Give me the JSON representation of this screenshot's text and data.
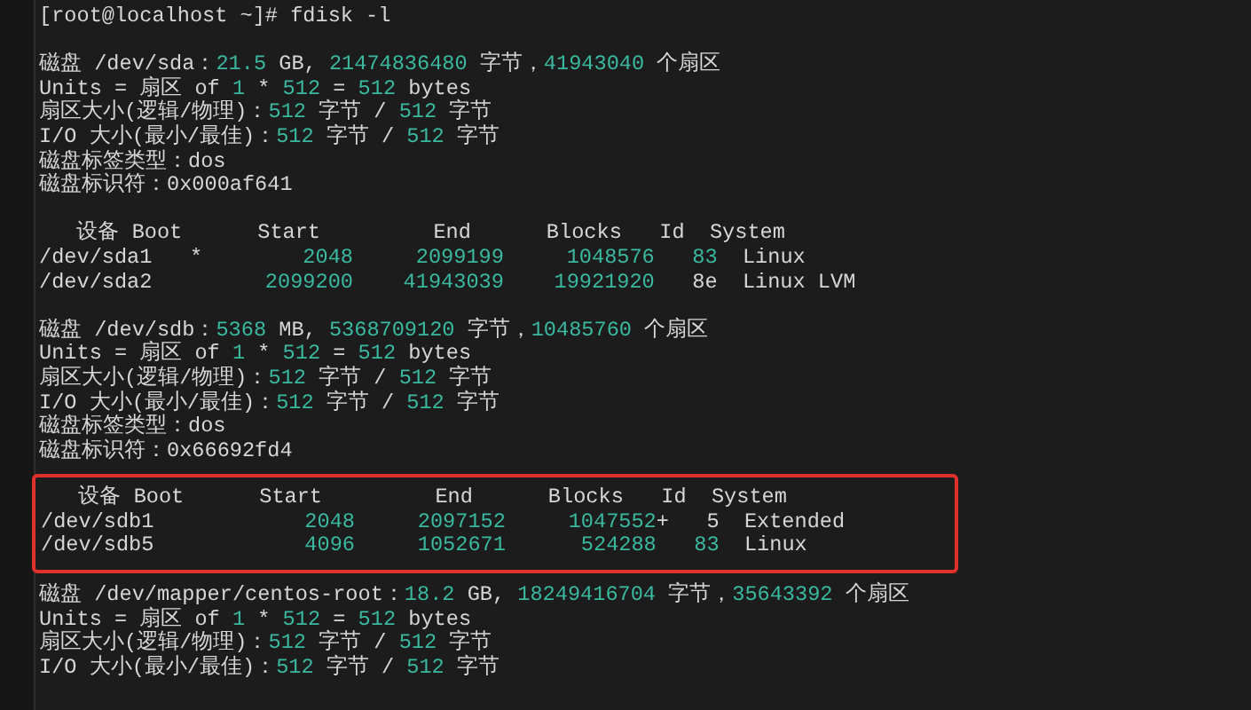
{
  "terminal": {
    "blocks": [
      {
        "highlighted": false,
        "lines": [
          {
            "kind": "text",
            "segments": [
              {
                "text": "[root@localhost ~]# fdisk -l",
                "kind": "plain"
              }
            ]
          },
          {
            "kind": "blank"
          },
          {
            "kind": "text",
            "segments": [
              {
                "text": "磁盘 /dev/sda：",
                "kind": "plain"
              },
              {
                "text": "21.5",
                "kind": "number"
              },
              {
                "text": " GB, ",
                "kind": "plain"
              },
              {
                "text": "21474836480",
                "kind": "number"
              },
              {
                "text": " 字节，",
                "kind": "plain"
              },
              {
                "text": "41943040",
                "kind": "number"
              },
              {
                "text": " 个扇区",
                "kind": "plain"
              }
            ]
          },
          {
            "kind": "text",
            "segments": [
              {
                "text": "Units = 扇区 of ",
                "kind": "plain"
              },
              {
                "text": "1",
                "kind": "number"
              },
              {
                "text": " * ",
                "kind": "plain"
              },
              {
                "text": "512",
                "kind": "number"
              },
              {
                "text": " = ",
                "kind": "plain"
              },
              {
                "text": "512",
                "kind": "number"
              },
              {
                "text": " bytes",
                "kind": "plain"
              }
            ]
          },
          {
            "kind": "text",
            "segments": [
              {
                "text": "扇区大小(逻辑/物理)：",
                "kind": "plain"
              },
              {
                "text": "512",
                "kind": "number"
              },
              {
                "text": " 字节 / ",
                "kind": "plain"
              },
              {
                "text": "512",
                "kind": "number"
              },
              {
                "text": " 字节",
                "kind": "plain"
              }
            ]
          },
          {
            "kind": "text",
            "segments": [
              {
                "text": "I/O 大小(最小/最佳)：",
                "kind": "plain"
              },
              {
                "text": "512",
                "kind": "number"
              },
              {
                "text": " 字节 / ",
                "kind": "plain"
              },
              {
                "text": "512",
                "kind": "number"
              },
              {
                "text": " 字节",
                "kind": "plain"
              }
            ]
          },
          {
            "kind": "text",
            "segments": [
              {
                "text": "磁盘标签类型：dos",
                "kind": "plain"
              }
            ]
          },
          {
            "kind": "text",
            "segments": [
              {
                "text": "磁盘标识符：0x000af641",
                "kind": "plain"
              }
            ]
          },
          {
            "kind": "blank"
          },
          {
            "kind": "text",
            "segments": [
              {
                "text": "   设备 Boot      Start         End      Blocks   Id  System",
                "kind": "plain"
              }
            ]
          },
          {
            "kind": "text",
            "segments": [
              {
                "text": "/dev/sda1   *",
                "kind": "plain"
              },
              {
                "text": "        2048     2099199     1048576   83",
                "kind": "number"
              },
              {
                "text": "  Linux",
                "kind": "plain"
              }
            ]
          },
          {
            "kind": "text",
            "segments": [
              {
                "text": "/dev/sda2",
                "kind": "plain"
              },
              {
                "text": "         2099200    41943039    19921920",
                "kind": "number"
              },
              {
                "text": "   8e  Linux LVM",
                "kind": "plain"
              }
            ]
          },
          {
            "kind": "blank"
          },
          {
            "kind": "text",
            "segments": [
              {
                "text": "磁盘 /dev/sdb：",
                "kind": "plain"
              },
              {
                "text": "5368",
                "kind": "number"
              },
              {
                "text": " MB, ",
                "kind": "plain"
              },
              {
                "text": "5368709120",
                "kind": "number"
              },
              {
                "text": " 字节，",
                "kind": "plain"
              },
              {
                "text": "10485760",
                "kind": "number"
              },
              {
                "text": " 个扇区",
                "kind": "plain"
              }
            ]
          },
          {
            "kind": "text",
            "segments": [
              {
                "text": "Units = 扇区 of ",
                "kind": "plain"
              },
              {
                "text": "1",
                "kind": "number"
              },
              {
                "text": " * ",
                "kind": "plain"
              },
              {
                "text": "512",
                "kind": "number"
              },
              {
                "text": " = ",
                "kind": "plain"
              },
              {
                "text": "512",
                "kind": "number"
              },
              {
                "text": " bytes",
                "kind": "plain"
              }
            ]
          },
          {
            "kind": "text",
            "segments": [
              {
                "text": "扇区大小(逻辑/物理)：",
                "kind": "plain"
              },
              {
                "text": "512",
                "kind": "number"
              },
              {
                "text": " 字节 / ",
                "kind": "plain"
              },
              {
                "text": "512",
                "kind": "number"
              },
              {
                "text": " 字节",
                "kind": "plain"
              }
            ]
          },
          {
            "kind": "text",
            "segments": [
              {
                "text": "I/O 大小(最小/最佳)：",
                "kind": "plain"
              },
              {
                "text": "512",
                "kind": "number"
              },
              {
                "text": " 字节 / ",
                "kind": "plain"
              },
              {
                "text": "512",
                "kind": "number"
              },
              {
                "text": " 字节",
                "kind": "plain"
              }
            ]
          },
          {
            "kind": "text",
            "segments": [
              {
                "text": "磁盘标签类型：dos",
                "kind": "plain"
              }
            ]
          },
          {
            "kind": "text",
            "segments": [
              {
                "text": "磁盘标识符：0x66692fd4",
                "kind": "plain"
              }
            ]
          }
        ]
      },
      {
        "highlighted": true,
        "lines": [
          {
            "kind": "text",
            "segments": [
              {
                "text": "   设备 Boot      Start         End      Blocks   Id  System",
                "kind": "plain"
              }
            ]
          },
          {
            "kind": "text",
            "segments": [
              {
                "text": "/dev/sdb1",
                "kind": "plain"
              },
              {
                "text": "            2048     2097152     1047552",
                "kind": "number"
              },
              {
                "text": "+   5  Extended",
                "kind": "plain"
              }
            ]
          },
          {
            "kind": "text",
            "segments": [
              {
                "text": "/dev/sdb5",
                "kind": "plain"
              },
              {
                "text": "            4096     1052671      524288   83",
                "kind": "number"
              },
              {
                "text": "  Linux",
                "kind": "plain"
              }
            ]
          }
        ]
      },
      {
        "highlighted": false,
        "lines": [
          {
            "kind": "text",
            "segments": [
              {
                "text": "磁盘 /dev/mapper/centos-root：",
                "kind": "plain"
              },
              {
                "text": "18.2",
                "kind": "number"
              },
              {
                "text": " GB, ",
                "kind": "plain"
              },
              {
                "text": "18249416704",
                "kind": "number"
              },
              {
                "text": " 字节，",
                "kind": "plain"
              },
              {
                "text": "35643392",
                "kind": "number"
              },
              {
                "text": " 个扇区",
                "kind": "plain"
              }
            ]
          },
          {
            "kind": "text",
            "segments": [
              {
                "text": "Units = 扇区 of ",
                "kind": "plain"
              },
              {
                "text": "1",
                "kind": "number"
              },
              {
                "text": " * ",
                "kind": "plain"
              },
              {
                "text": "512",
                "kind": "number"
              },
              {
                "text": " = ",
                "kind": "plain"
              },
              {
                "text": "512",
                "kind": "number"
              },
              {
                "text": " bytes",
                "kind": "plain"
              }
            ]
          },
          {
            "kind": "text",
            "segments": [
              {
                "text": "扇区大小(逻辑/物理)：",
                "kind": "plain"
              },
              {
                "text": "512",
                "kind": "number"
              },
              {
                "text": " 字节 / ",
                "kind": "plain"
              },
              {
                "text": "512",
                "kind": "number"
              },
              {
                "text": " 字节",
                "kind": "plain"
              }
            ]
          },
          {
            "kind": "text",
            "segments": [
              {
                "text": "I/O 大小(最小/最佳)：",
                "kind": "plain"
              },
              {
                "text": "512",
                "kind": "number"
              },
              {
                "text": " 字节 / ",
                "kind": "plain"
              },
              {
                "text": "512",
                "kind": "number"
              },
              {
                "text": " 字节",
                "kind": "plain"
              }
            ]
          }
        ]
      }
    ]
  }
}
